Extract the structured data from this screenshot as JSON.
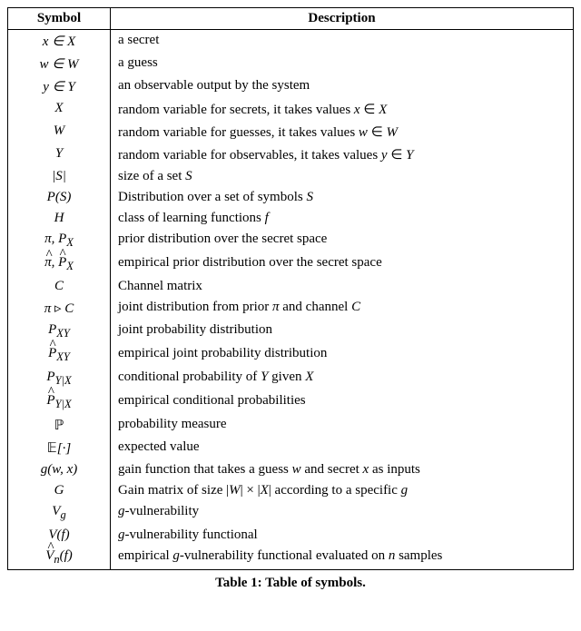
{
  "table": {
    "header": {
      "symbol": "Symbol",
      "description": "Description"
    },
    "rows": [
      {
        "sym": "x ∈ 𝒳",
        "desc": "a secret"
      },
      {
        "sym": "w ∈ 𝒲",
        "desc": "a guess"
      },
      {
        "sym": "y ∈ 𝒴",
        "desc": "an observable output by the system"
      },
      {
        "sym": "X",
        "desc": "random variable for secrets, it takes values x ∈ 𝒳"
      },
      {
        "sym": "W",
        "desc": "random variable for guesses, it takes values w ∈ 𝒲"
      },
      {
        "sym": "Y",
        "desc": "random variable for observables, it takes values y ∈ 𝒴"
      },
      {
        "sym": "|𝒮|",
        "desc": "size of a set 𝒮"
      },
      {
        "sym": "𝒫(𝒮)",
        "desc": "Distribution over a set of symbols 𝒮"
      },
      {
        "sym": "ℋ",
        "desc": "class of learning functions f"
      },
      {
        "sym": "π, P_X",
        "desc": "prior distribution over the secret space"
      },
      {
        "sym": "π̂, P̂_X",
        "desc": "empirical prior distribution over the secret space"
      },
      {
        "sym": "C",
        "desc": "Channel matrix"
      },
      {
        "sym": "π ▹ C",
        "desc": "joint distribution from prior π and channel C"
      },
      {
        "sym": "P_XY",
        "desc": "joint probability distribution"
      },
      {
        "sym": "P̂_XY",
        "desc": "empirical joint probability distribution"
      },
      {
        "sym": "P_Y|X",
        "desc": "conditional probability of Y given X"
      },
      {
        "sym": "P̂_Y|X",
        "desc": "empirical conditional probabilities"
      },
      {
        "sym": "ℙ",
        "desc": "probability measure"
      },
      {
        "sym": "𝔼[·]",
        "desc": "expected value"
      },
      {
        "sym": "g(w, x)",
        "desc": "gain function that takes a guess w and secret x as inputs"
      },
      {
        "sym": "G",
        "desc": "Gain matrix of size |𝒲| × |𝒳| according to a specific g"
      },
      {
        "sym": "V_g",
        "desc": "g-vulnerability"
      },
      {
        "sym": "V(f)",
        "desc": "g-vulnerability functional"
      },
      {
        "sym": "V̂_n(f)",
        "desc": "empirical g-vulnerability functional evaluated on n samples"
      }
    ],
    "caption": "Table 1: Table of symbols."
  }
}
